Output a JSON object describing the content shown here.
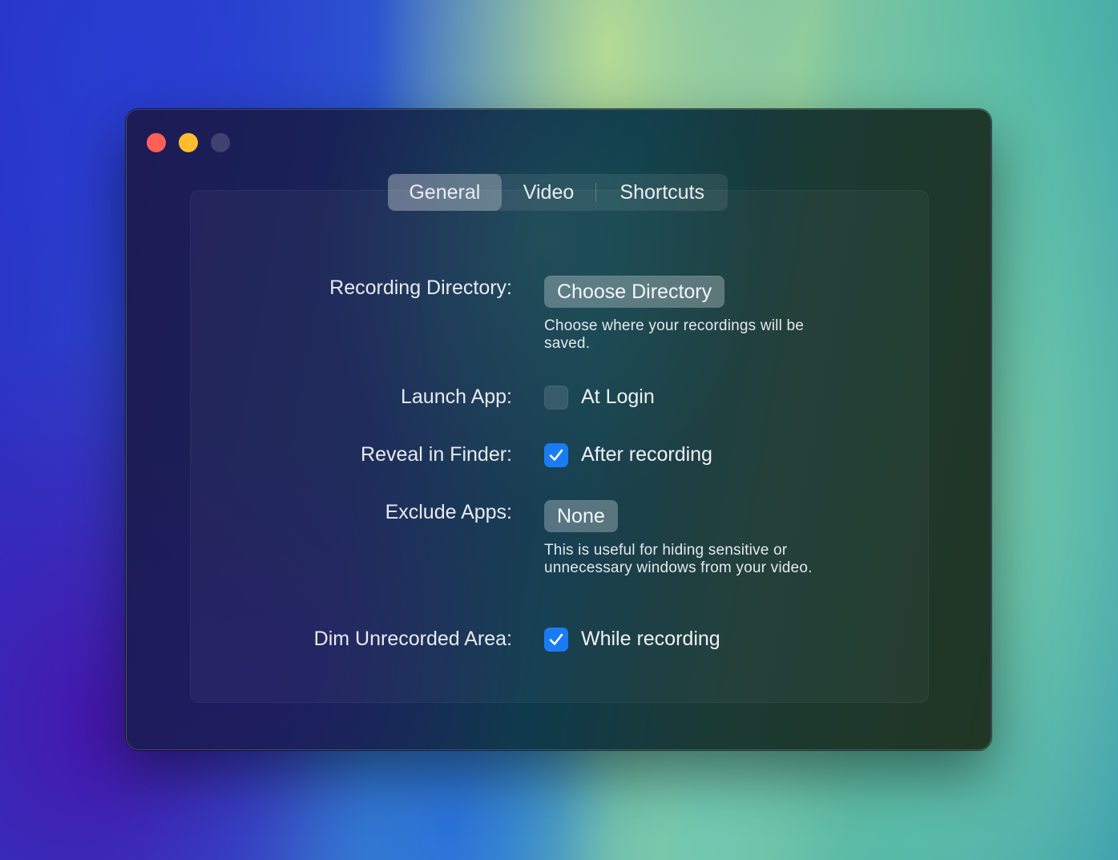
{
  "window": {
    "traffic_lights": {
      "close_color": "#fe5f57",
      "minimize_color": "#febc2e",
      "zoom_color": "#4a4f6a"
    }
  },
  "tabs": [
    {
      "label": "General",
      "active": true
    },
    {
      "label": "Video",
      "active": false
    },
    {
      "label": "Shortcuts",
      "active": false
    }
  ],
  "settings": {
    "recording_directory": {
      "label": "Recording Directory:",
      "button_label": "Choose Directory",
      "help_text": "Choose where your recordings will be saved."
    },
    "launch_app": {
      "label": "Launch App:",
      "option_label": "At Login",
      "checked": false
    },
    "reveal_in_finder": {
      "label": "Reveal in Finder:",
      "option_label": "After recording",
      "checked": true
    },
    "exclude_apps": {
      "label": "Exclude Apps:",
      "button_label": "None",
      "help_text": "This is useful for hiding sensitive or unnecessary windows from your video."
    },
    "dim_unrecorded_area": {
      "label": "Dim Unrecorded Area:",
      "option_label": "While recording",
      "checked": true
    }
  },
  "colors": {
    "accent": "#1a7cf5"
  }
}
